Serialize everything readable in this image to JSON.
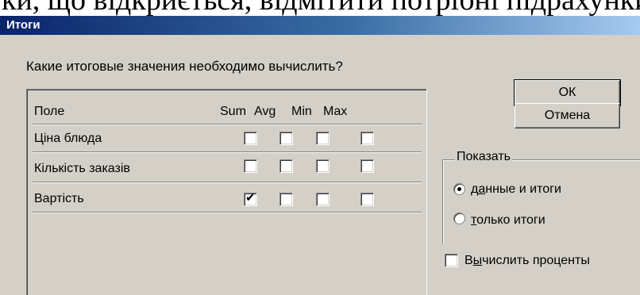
{
  "document_background_text": "ки, що відкриється, відмітити потрібні підрахунки",
  "dialog": {
    "title": "Итоги",
    "question": "Какие итоговые значения необходимо вычислить?",
    "ok_label": "ОК",
    "cancel_label": "Отмена"
  },
  "table": {
    "field_header": "Поле",
    "columns": [
      "Sum",
      "Avg",
      "Min",
      "Max"
    ],
    "rows": [
      {
        "name": "Ціна блюда",
        "checks": [
          false,
          false,
          false,
          false
        ]
      },
      {
        "name": "Кількість заказів",
        "checks": [
          false,
          false,
          false,
          false
        ]
      },
      {
        "name": "Вартість",
        "checks": [
          true,
          false,
          false,
          false
        ]
      }
    ]
  },
  "show_group": {
    "legend": "Показать",
    "option_detail_prefix": "д",
    "option_detail_accel": "а",
    "option_detail_rest": "нные и итоги",
    "option_summary_accel": "т",
    "option_summary_rest": "олько итоги",
    "selected": "detail"
  },
  "percent": {
    "prefix": "В",
    "accel": "ы",
    "rest": "числить проценты",
    "checked": false
  }
}
